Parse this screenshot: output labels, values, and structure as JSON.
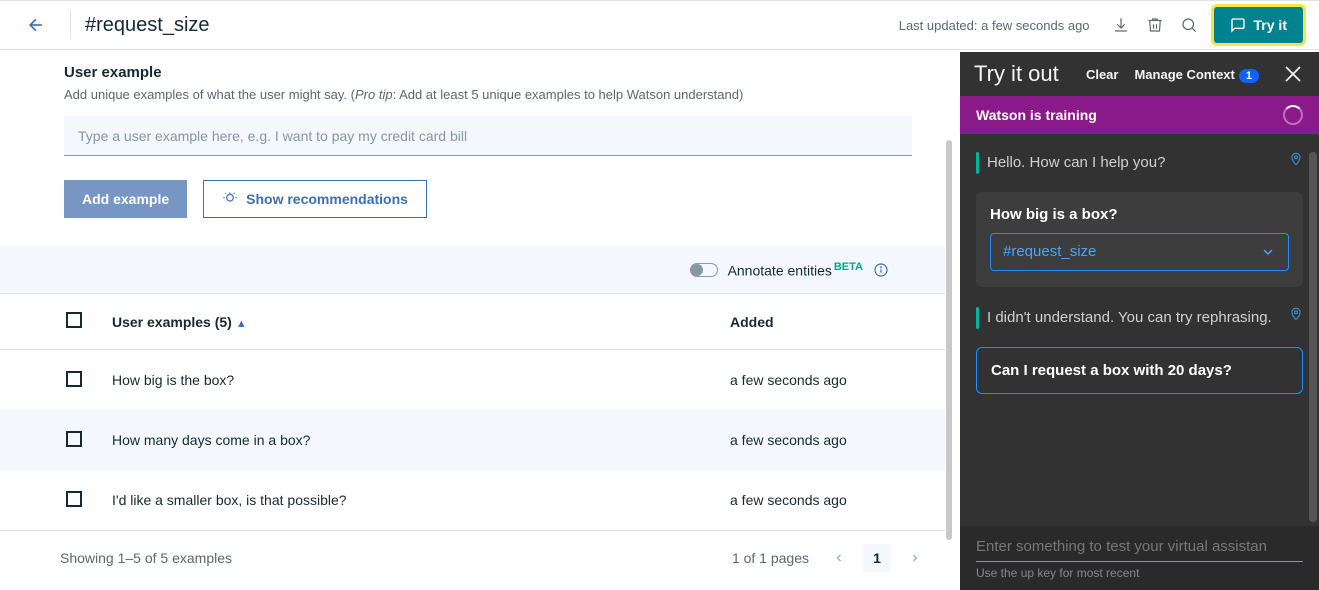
{
  "header": {
    "title": "#request_size",
    "last_updated": "Last updated: a few seconds ago",
    "tryit_label": "Try it"
  },
  "example_section": {
    "heading": "User example",
    "sub_prefix": "Add unique examples of what the user might say. (",
    "sub_protip_label": "Pro tip",
    "sub_suffix": ": Add at least 5 unique examples to help Watson understand)",
    "placeholder": "Type a user example here, e.g. I want to pay my credit card bill",
    "add_label": "Add example",
    "show_rec_label": "Show recommendations"
  },
  "annotate": {
    "label": "Annotate entities",
    "beta": "BETA"
  },
  "table": {
    "header_examples": "User examples (5)",
    "header_added": "Added",
    "rows": [
      {
        "text": "How big is the box?",
        "added": "a few seconds ago"
      },
      {
        "text": "How many days come in a box?",
        "added": "a few seconds ago"
      },
      {
        "text": "I'd like a smaller box, is that possible?",
        "added": "a few seconds ago"
      }
    ],
    "footer_showing": "Showing 1–5 of 5 examples",
    "footer_pages": "1 of 1 pages",
    "page_current": "1"
  },
  "panel": {
    "title": "Try it out",
    "clear": "Clear",
    "manage": "Manage Context",
    "badge": "1",
    "training": "Watson is training",
    "bot1": "Hello. How can I help you?",
    "user1_q": "How big is a box?",
    "user1_intent": "#request_size",
    "bot2": "I didn't understand. You can try rephrasing.",
    "user2_q": "Can I request a box with 20 days?",
    "input_placeholder": "Enter something to test your virtual assistan",
    "input_hint": "Use the up key for most recent"
  }
}
